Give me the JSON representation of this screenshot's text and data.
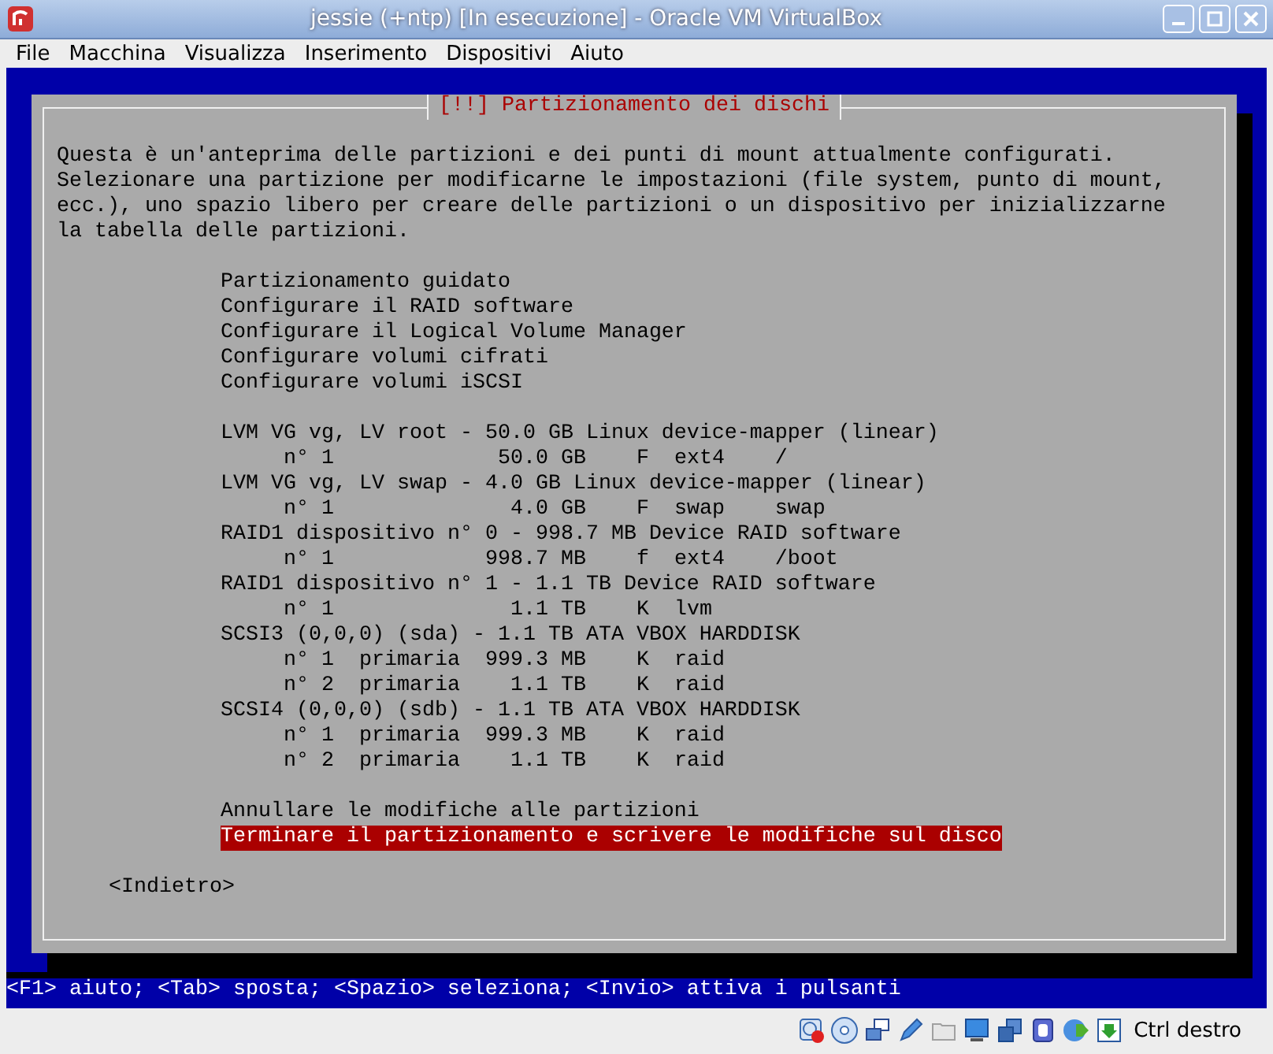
{
  "window": {
    "title": "jessie (+ntp) [In esecuzione] - Oracle VM VirtualBox"
  },
  "menu_bar": [
    "File",
    "Macchina",
    "Visualizza",
    "Inserimento",
    "Dispositivi",
    "Aiuto"
  ],
  "dialog": {
    "title": "[!!] Partizionamento dei dischi",
    "description_lines": [
      "Questa è un'anteprima delle partizioni e dei punti di mount attualmente configurati.",
      "Selezionare una partizione per modificarne le impostazioni (file system, punto di mount,",
      "ecc.), uno spazio libero per creare delle partizioni o un dispositivo per inizializzarne",
      "la tabella delle partizioni."
    ],
    "actions": [
      {
        "text": "Partizionamento guidato",
        "selected": false
      },
      {
        "text": "Configurare il RAID software",
        "selected": false
      },
      {
        "text": "Configurare il Logical Volume Manager",
        "selected": false
      },
      {
        "text": "Configurare volumi cifrati",
        "selected": false
      },
      {
        "text": "Configurare volumi iSCSI",
        "selected": false
      }
    ],
    "devices": [
      {
        "text": "LVM VG vg, LV root - 50.0 GB Linux device-mapper (linear)",
        "selected": false,
        "children": [
          {
            "text": "n° 1             50.0 GB    F  ext4    /",
            "selected": false
          }
        ]
      },
      {
        "text": "LVM VG vg, LV swap - 4.0 GB Linux device-mapper (linear)",
        "selected": false,
        "children": [
          {
            "text": "n° 1              4.0 GB    F  swap    swap",
            "selected": false
          }
        ]
      },
      {
        "text": "RAID1 dispositivo n° 0 - 998.7 MB Device RAID software",
        "selected": false,
        "children": [
          {
            "text": "n° 1            998.7 MB    f  ext4    /boot",
            "selected": false
          }
        ]
      },
      {
        "text": "RAID1 dispositivo n° 1 - 1.1 TB Device RAID software",
        "selected": false,
        "children": [
          {
            "text": "n° 1              1.1 TB    K  lvm",
            "selected": false
          }
        ]
      },
      {
        "text": "SCSI3 (0,0,0) (sda) - 1.1 TB ATA VBOX HARDDISK",
        "selected": false,
        "children": [
          {
            "text": "n° 1  primaria  999.3 MB    K  raid",
            "selected": false
          },
          {
            "text": "n° 2  primaria    1.1 TB    K  raid",
            "selected": false
          }
        ]
      },
      {
        "text": "SCSI4 (0,0,0) (sdb) - 1.1 TB ATA VBOX HARDDISK",
        "selected": false,
        "children": [
          {
            "text": "n° 1  primaria  999.3 MB    K  raid",
            "selected": false
          },
          {
            "text": "n° 2  primaria    1.1 TB    K  raid",
            "selected": false
          }
        ]
      }
    ],
    "commands": [
      {
        "text": "Annullare le modifiche alle partizioni",
        "selected": false
      },
      {
        "text": "Terminare il partizionamento e scrivere le modifiche sul disco",
        "selected": true
      }
    ],
    "back_button": {
      "label": "<Indietro>",
      "selected": false
    }
  },
  "help_line": "<F1> aiuto; <Tab> sposta; <Spazio> seleziona; <Invio> attiva i pulsanti",
  "status_bar": {
    "host_key": "Ctrl destro"
  }
}
